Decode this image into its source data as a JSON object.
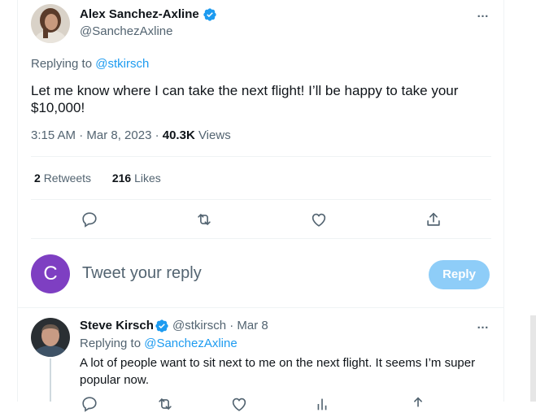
{
  "main_tweet": {
    "author_name": "Alex Sanchez-Axline",
    "author_handle": "@SanchezAxline",
    "replying_prefix": "Replying to",
    "replying_to": "@stkirsch",
    "text": "Let me know where I can take the next flight! I’ll be happy to take your $10,000!",
    "time": "3:15 AM · Mar 8, 2023 · ",
    "views_count": "40.3K",
    "views_label": " Views",
    "retweets_count": "2",
    "retweets_label": "Retweets",
    "likes_count": "216",
    "likes_label": "Likes",
    "more_icon": "…"
  },
  "compose": {
    "avatar_letter": "C",
    "placeholder": "Tweet your reply",
    "reply_button": "Reply"
  },
  "reply_tweet": {
    "author_name": "Steve Kirsch",
    "author_handle": "@stkirsch · Mar 8",
    "replying_prefix": "Replying to",
    "replying_to": "@SanchezAxline",
    "text": "A lot of people want to sit next to me on the next flight. It seems I’m super popular now.",
    "more_icon": "…"
  },
  "colors": {
    "accent": "#1d9bf0",
    "reply_button_disabled": "#8ecdf8",
    "compose_avatar": "#7e3fc2",
    "secondary_text": "#536471"
  }
}
